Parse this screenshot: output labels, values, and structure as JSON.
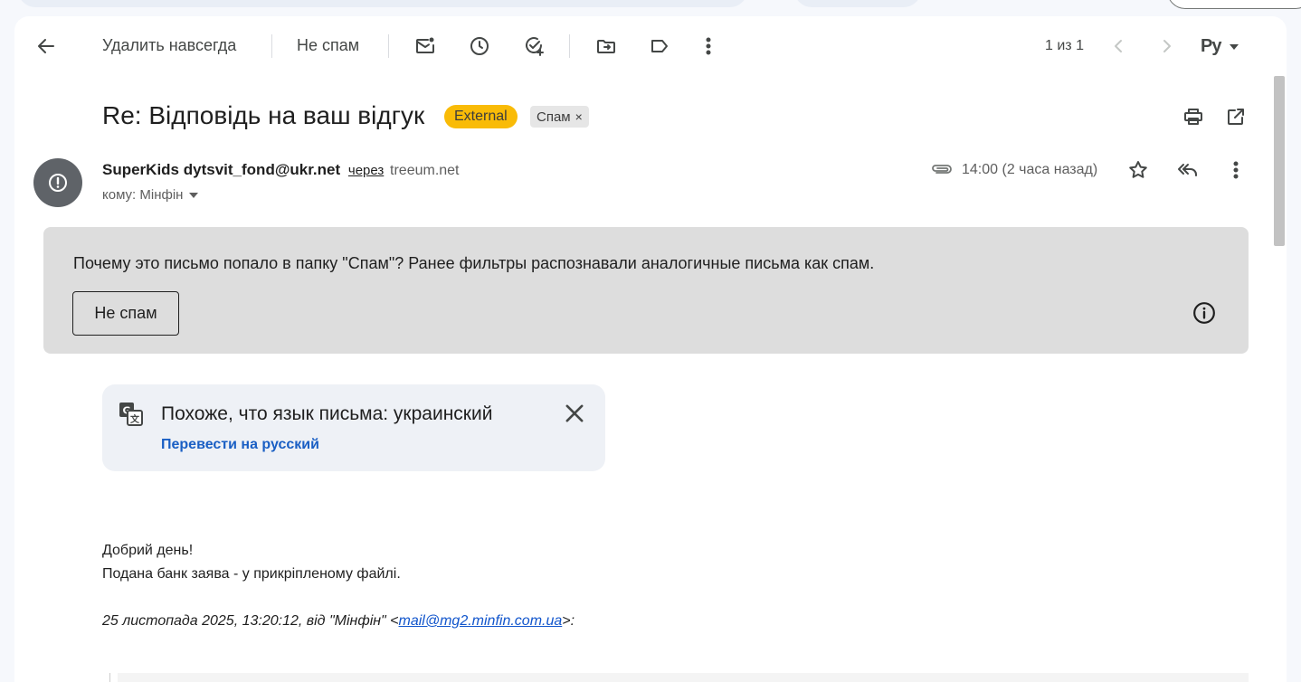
{
  "toolbar": {
    "delete_forever_label": "Удалить навсегда",
    "not_spam_label": "Не спам",
    "pagination": "1 из 1",
    "input_tools_label": "Ру"
  },
  "message": {
    "subject": "Re: Відповідь на ваш відгук",
    "labels": {
      "external": "External",
      "spam": "Спам",
      "remove": "×"
    },
    "sender_name": "SuperKids",
    "sender_email": "dytsvit_fond@ukr.net",
    "via_text": "через",
    "via_domain": "treeum.net",
    "recipient": "кому: Мінфін",
    "time": "14:00 (2 часа назад)"
  },
  "spam_notice": {
    "question": "Почему это письмо попало в папку \"Спам\"?",
    "explanation": " Ранее фильтры распознавали аналогичные письма как спам.",
    "button_label": "Не спам"
  },
  "translate": {
    "title": "Похоже, что язык письма: украинский",
    "action": "Перевести на русский"
  },
  "body": {
    "line1": "Добрий день!",
    "line2": "Подана банк заява - у прикріпленому файлі.",
    "quote_prefix": "25 листопада 2025, 13:20:12, від \"Мінфін\" <",
    "quote_email": "mail@mg2.minfin.com.ua",
    "quote_suffix": ">:"
  },
  "colors": {
    "external_badge": "#f9bb07",
    "spam_notice_bg": "#dddddd",
    "link": "#1a5fc4",
    "avatar": "#5f6368"
  },
  "icons": {
    "back": "arrow-left-icon",
    "mark_unread": "mail-unread-icon",
    "snooze": "clock-icon",
    "add_task": "task-add-icon",
    "move_to": "folder-move-icon",
    "label": "label-icon",
    "more": "more-vert-icon",
    "prev": "chevron-left-icon",
    "next": "chevron-right-icon",
    "print": "print-icon",
    "open_new_window": "open-in-new-icon",
    "spam_avatar": "alert-icon",
    "attachment": "paperclip-icon",
    "star": "star-icon",
    "reply_all": "reply-all-icon",
    "info": "info-icon",
    "translate": "translate-icon",
    "close": "close-icon"
  }
}
